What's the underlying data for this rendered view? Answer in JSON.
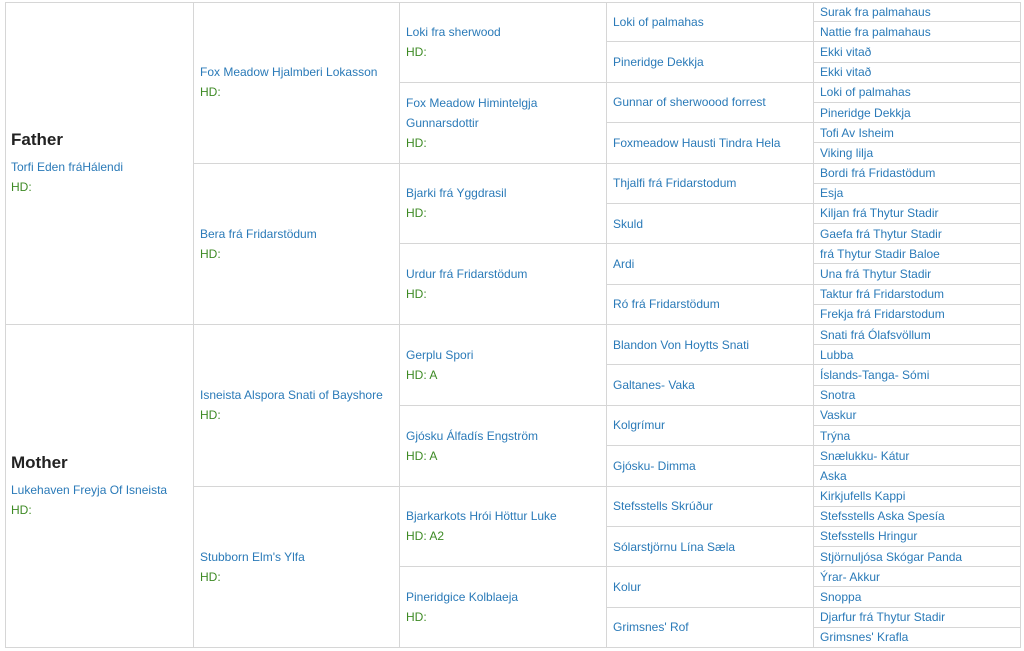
{
  "pedigree": {
    "father": {
      "role": "Father",
      "name": "Torfi Eden fráHálendi",
      "hd": "HD:",
      "sire": {
        "name": "Fox Meadow Hjalmberi Lokasson",
        "hd": "HD:",
        "sire": {
          "name": "Loki fra sherwood",
          "hd": "HD:",
          "sire": {
            "name": "Loki of palmahas",
            "sire": "Surak fra palmahaus",
            "dam": "Nattie fra palmahaus"
          },
          "dam": {
            "name": "Pineridge Dekkja",
            "sire": "Ekki vitað",
            "dam": "Ekki vitað"
          }
        },
        "dam": {
          "name": "Fox Meadow Himintelgja Gunnarsdottir",
          "hd": "HD:",
          "sire": {
            "name": "Gunnar of sherwoood forrest",
            "sire": "Loki of palmahas",
            "dam": "Pineridge Dekkja"
          },
          "dam": {
            "name": "Foxmeadow Hausti Tindra Hela",
            "sire": "Tofi Av Isheim",
            "dam": "Viking lilja"
          }
        }
      },
      "dam": {
        "name": "Bera frá Fridarstödum",
        "hd": "HD:",
        "sire": {
          "name": "Bjarki frá Yggdrasil",
          "hd": "HD:",
          "sire": {
            "name": "Thjalfi frá Fridarstodum",
            "sire": "Bordi frá Fridastödum",
            "dam": "Esja"
          },
          "dam": {
            "name": "Skuld",
            "sire": "Kiljan frá Thytur Stadir",
            "dam": "Gaefa frá Thytur Stadir"
          }
        },
        "dam": {
          "name": "Urdur frá Fridarstödum",
          "hd": "HD:",
          "sire": {
            "name": "Ardi",
            "sire": "frá Thytur Stadir Baloe",
            "dam": "Una frá Thytur Stadir"
          },
          "dam": {
            "name": "Ró frá Fridarstödum",
            "sire": "Taktur frá Fridarstodum",
            "dam": "Frekja frá Fridarstodum"
          }
        }
      }
    },
    "mother": {
      "role": "Mother",
      "name": "Lukehaven Freyja Of Isneista",
      "hd": "HD:",
      "sire": {
        "name": "Isneista Alspora Snati of Bayshore",
        "hd": "HD:",
        "sire": {
          "name": "Gerplu Spori",
          "hd": "HD: A",
          "sire": {
            "name": "Blandon Von Hoytts Snati",
            "sire": "Snati frá Ólafsvöllum",
            "dam": "Lubba"
          },
          "dam": {
            "name": "Galtanes- Vaka",
            "sire": "Íslands-Tanga- Sómi",
            "dam": "Snotra"
          }
        },
        "dam": {
          "name": "Gjósku Álfadís Engström",
          "hd": "HD: A",
          "sire": {
            "name": "Kolgrímur",
            "sire": "Vaskur",
            "dam": "Trýna"
          },
          "dam": {
            "name": "Gjósku- Dimma",
            "sire": "Snælukku- Kátur",
            "dam": "Aska"
          }
        }
      },
      "dam": {
        "name": "Stubborn Elm's Ylfa",
        "hd": "HD:",
        "sire": {
          "name": "Bjarkarkots Hrói Höttur Luke",
          "hd": "HD: A2",
          "sire": {
            "name": "Stefsstells Skrúður",
            "sire": "Kirkjufells Kappi",
            "dam": "Stefsstells Aska Spesía"
          },
          "dam": {
            "name": "Sólarstjörnu Lína Sæla",
            "sire": "Stefsstells Hringur",
            "dam": "Stjörnuljósa Skógar Panda"
          }
        },
        "dam": {
          "name": "Pineridgice Kolblaeja",
          "hd": "HD:",
          "sire": {
            "name": "Kolur",
            "sire": "Ýrar- Akkur",
            "dam": "Snoppa"
          },
          "dam": {
            "name": "Grimsnes' Rof",
            "sire": "Djarfur frá Thytur Stadir",
            "dam": "Grimsnes' Krafla"
          }
        }
      }
    }
  }
}
